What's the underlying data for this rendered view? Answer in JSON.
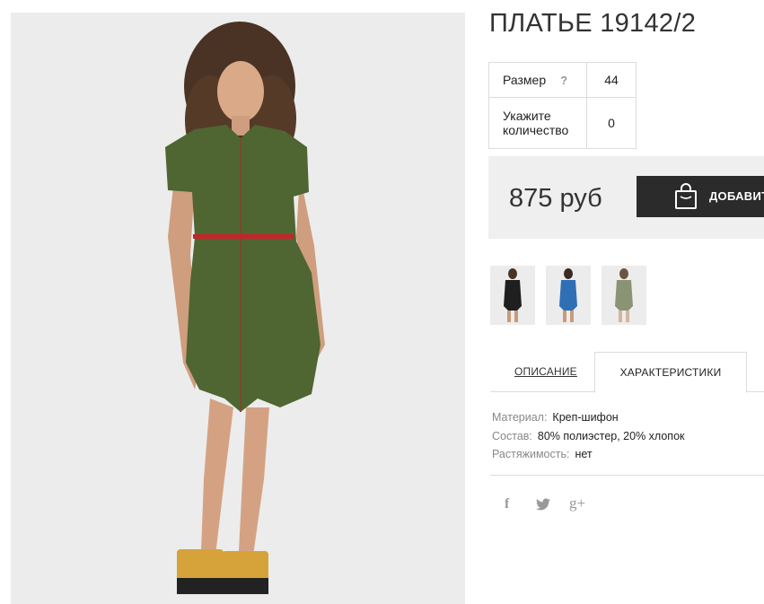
{
  "product": {
    "title": "ПЛАТЬЕ 19142/2",
    "main_image": "woman-in-green-dress-photo"
  },
  "options": {
    "size_label": "Размер",
    "size_help": "?",
    "size_value": "44",
    "qty_label_line1": "Укажите",
    "qty_label_line2": "количество",
    "qty_value": "0"
  },
  "purchase": {
    "price": "875 руб",
    "add_label": "ДОБАВИТ",
    "bag_icon": "shopping-bag-icon"
  },
  "thumbnails": [
    {
      "name": "thumbnail-black-dress",
      "color": "#1f1f1f"
    },
    {
      "name": "thumbnail-blue-dress",
      "color": "#2f6fb5"
    },
    {
      "name": "thumbnail-green-dress",
      "color": "#8a9475"
    }
  ],
  "tabs": {
    "description": "ОПИСАНИЕ",
    "characteristics": "ХАРАКТЕРИСТИКИ",
    "active": "characteristics"
  },
  "specs": [
    {
      "key": "Материал:",
      "value": "Креп-шифон"
    },
    {
      "key": "Состав:",
      "value": "80% полиэстер, 20% хлопок"
    },
    {
      "key": "Растяжимость:",
      "value": "нет"
    }
  ],
  "social": {
    "facebook": "f",
    "twitter": "twitter-bird-icon",
    "google_plus": "g+"
  },
  "colors": {
    "dress_green": "#4f6532",
    "button_dark": "#2b2b2b",
    "price_bg": "#efefef",
    "border": "#dcdcdc"
  }
}
